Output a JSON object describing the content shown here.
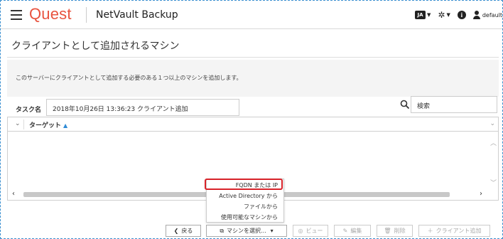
{
  "header": {
    "logo": "Quest",
    "product": "NetVault Backup",
    "chat_badge": "JA",
    "user_label": "default"
  },
  "page": {
    "title": "クライアントとして追加されるマシン",
    "info": "このサーバーにクライアントとして追加する必要のある１つ以上のマシンを追加します。"
  },
  "task": {
    "label": "タスク名",
    "value": "2018年10月26日 13:36:23 クライアント追加"
  },
  "search": {
    "placeholder": "検索"
  },
  "table": {
    "column_target": "ターゲット"
  },
  "dropdown": {
    "items": [
      "FQDN または IP",
      "Active Directory から",
      "ファイルから",
      "使用可能なマシンから"
    ]
  },
  "buttons": {
    "back": "戻る",
    "select_machine": "マシンを選択...",
    "view": "ビュー",
    "edit": "編集",
    "delete": "削除",
    "add_client": "クライアント追加"
  },
  "colors": {
    "brand": "#e8533f",
    "highlight": "#d8232a",
    "sort_arrow": "#2f8bd6"
  }
}
